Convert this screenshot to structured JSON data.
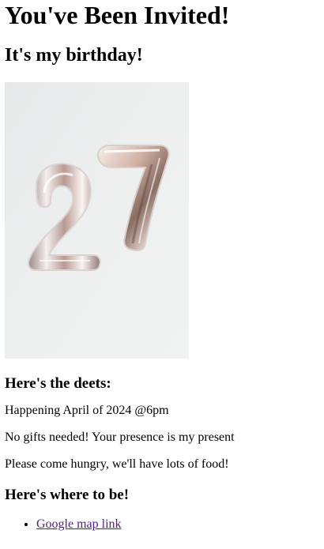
{
  "header": {
    "title": "You've Been Invited!",
    "subtitle": "It's my birthday!"
  },
  "photo": {
    "alt": "Silver number 27 balloons",
    "colors": {
      "background": "#eceeee",
      "balloon_light": "#f4ecea",
      "balloon_mid": "#c9a9a0",
      "balloon_dark": "#6e5850"
    }
  },
  "details": {
    "heading": "Here's the deets:",
    "lines": [
      "Happening April of 2024 @6pm",
      "No gifts needed! Your presence is my present",
      "Please come hungry, we'll have lots of food!"
    ]
  },
  "location": {
    "heading": "Here's where to be!",
    "links": [
      {
        "label": "Google map link"
      }
    ]
  },
  "colors": {
    "link_visited": "#551a8b",
    "text": "#000000"
  }
}
